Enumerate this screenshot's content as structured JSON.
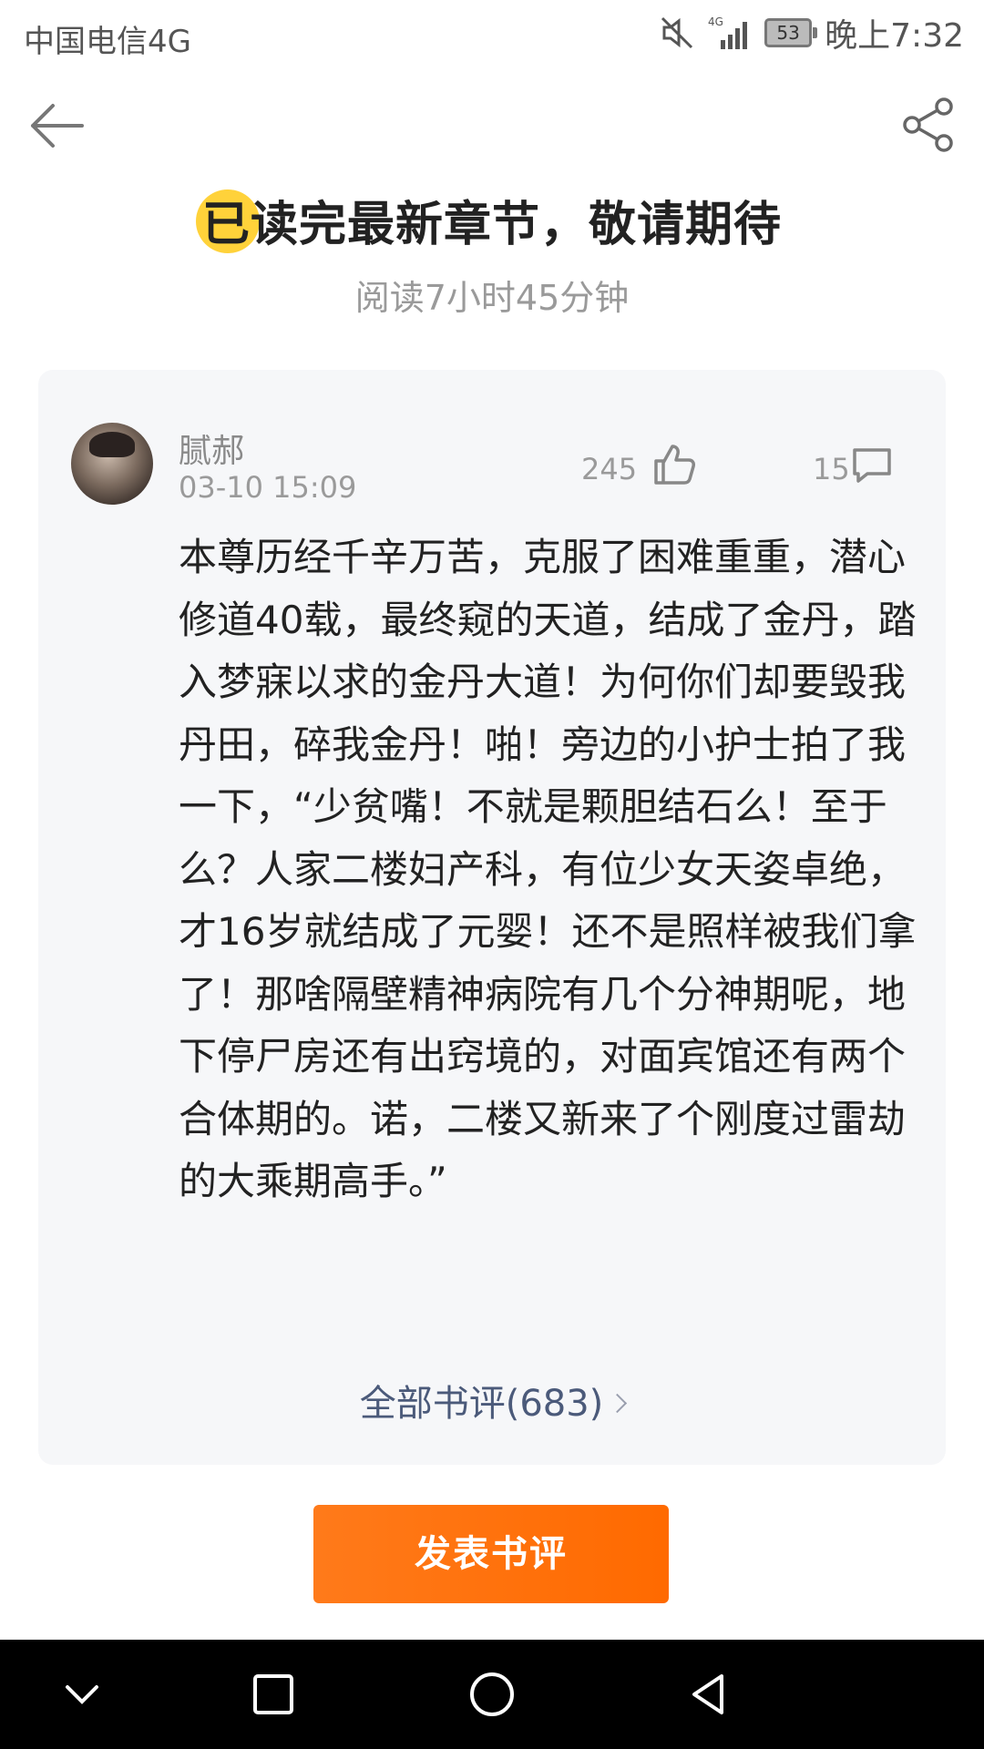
{
  "status_bar": {
    "carrier": "中国电信4G",
    "battery": "53",
    "time": "晚上7:32",
    "icons": [
      "mute-icon",
      "signal-icon",
      "battery-icon"
    ]
  },
  "nav": {
    "back_icon": "arrow-left-icon",
    "share_icon": "share-icon"
  },
  "header": {
    "title": "已读完最新章节，敬请期待",
    "read_time": "阅读7小时45分钟"
  },
  "comment": {
    "username": "腻郝",
    "time": "03-10 15:09",
    "likes": "245",
    "replies": "15",
    "body": "本尊历经千辛万苦，克服了困难重重，潜心修道40载，最终窥的天道，结成了金丹，踏入梦寐以求的金丹大道！为何你们却要毁我丹田，碎我金丹！啪！旁边的小护士拍了我一下，“少贫嘴！不就是颗胆结石么！至于么？人家二楼妇产科，有位少女天姿卓绝，才16岁就结成了元婴！还不是照样被我们拿了！那啥隔壁精神病院有几个分神期呢，地下停尸房还有出窍境的，对面宾馆还有两个合体期的。诺，二楼又新来了个刚度过雷劫的大乘期高手。”",
    "all_reviews": "全部书评(683)"
  },
  "actions": {
    "publish_label": "发表书评"
  },
  "colors": {
    "accent": "#ff6a00",
    "title_dot": "#ffd23a",
    "link": "#4b5a7a"
  }
}
